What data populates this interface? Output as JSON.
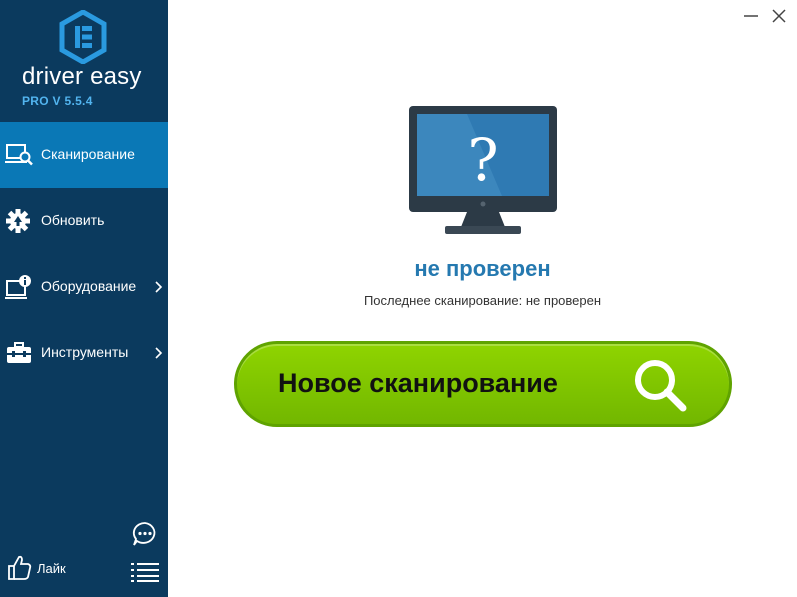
{
  "app": {
    "name": "driver easy",
    "version": "PRO V 5.5.4"
  },
  "sidebar": {
    "items": [
      {
        "label": "Сканирование",
        "icon": "monitor-search-icon",
        "active": true
      },
      {
        "label": "Обновить",
        "icon": "gear-update-icon",
        "active": false
      },
      {
        "label": "Оборудование",
        "icon": "hardware-info-icon",
        "active": false
      },
      {
        "label": "Инструменты",
        "icon": "toolbox-icon",
        "active": false
      }
    ],
    "like_label": "Лайк"
  },
  "main": {
    "status_title": "не проверен",
    "status_sub": "Последнее сканирование: не проверен",
    "scan_button_label": "Новое сканирование"
  },
  "colors": {
    "sidebar_bg": "#0b3a5e",
    "active_item": "#0a78b6",
    "status_title": "#2579b0",
    "scan_button": "#7fc400"
  }
}
